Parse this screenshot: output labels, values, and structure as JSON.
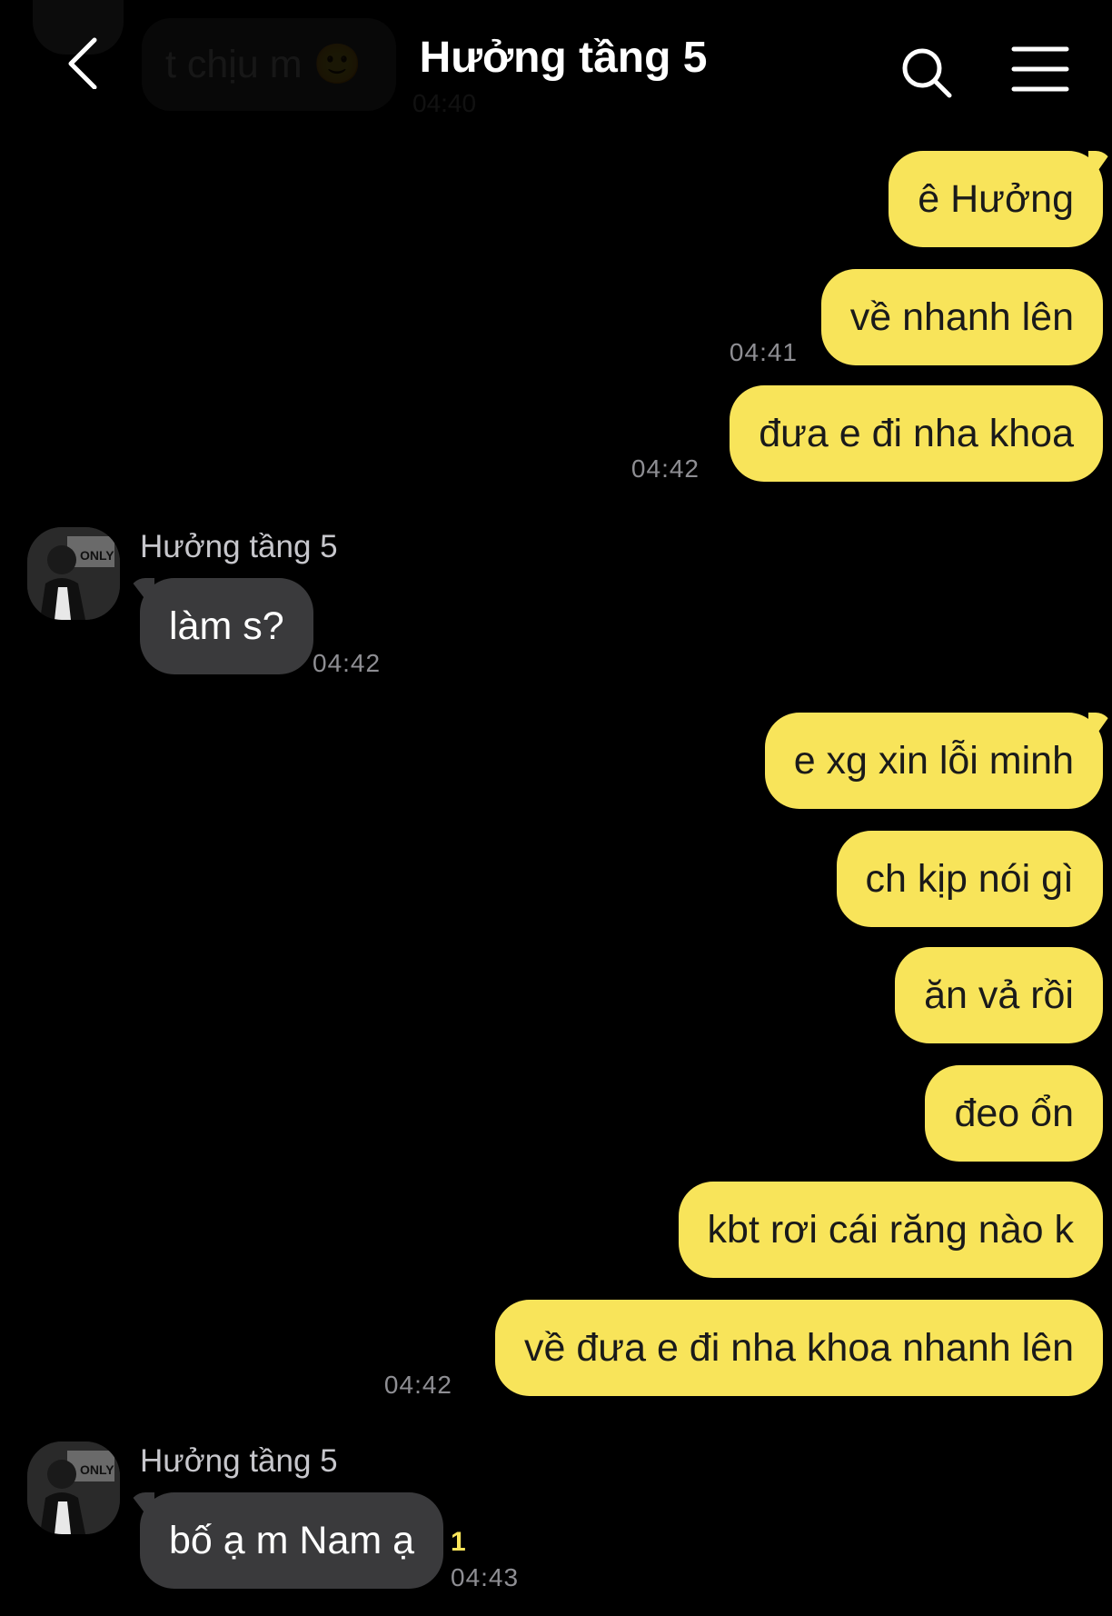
{
  "header": {
    "title": "Hưởng tầng 5",
    "back_icon": "chevron-left-icon",
    "search_icon": "search-icon",
    "menu_icon": "menu-icon"
  },
  "previous_message": {
    "text": "t chịu m 🙂",
    "time": "04:40"
  },
  "contact": {
    "name": "Hưởng tầng 5",
    "avatar_badge": "ONLY"
  },
  "messages": [
    {
      "direction": "out",
      "text": "ê Hưởng"
    },
    {
      "direction": "out",
      "text": "về nhanh lên",
      "time": "04:41"
    },
    {
      "direction": "out",
      "text": "đưa e đi nha khoa",
      "time": "04:42"
    },
    {
      "direction": "in",
      "sender": "Hưởng tầng 5",
      "text": "làm s?",
      "time": "04:42"
    },
    {
      "direction": "out",
      "text": "e xg xin lỗi minh"
    },
    {
      "direction": "out",
      "text": "ch kịp nói gì"
    },
    {
      "direction": "out",
      "text": "ăn vả rồi"
    },
    {
      "direction": "out",
      "text": "đeo ổn"
    },
    {
      "direction": "out",
      "text": "kbt rơi cái răng nào k"
    },
    {
      "direction": "out",
      "text": "về đưa e đi nha khoa nhanh lên",
      "time": "04:42"
    },
    {
      "direction": "in",
      "sender": "Hưởng tầng 5",
      "text": "bố ạ m Nam ạ",
      "unread": "1",
      "time": "04:43"
    }
  ],
  "colors": {
    "background": "#000000",
    "outgoing_bubble": "#f8e45a",
    "incoming_bubble": "#3a3a3c",
    "unread_count": "#f8e45a"
  }
}
